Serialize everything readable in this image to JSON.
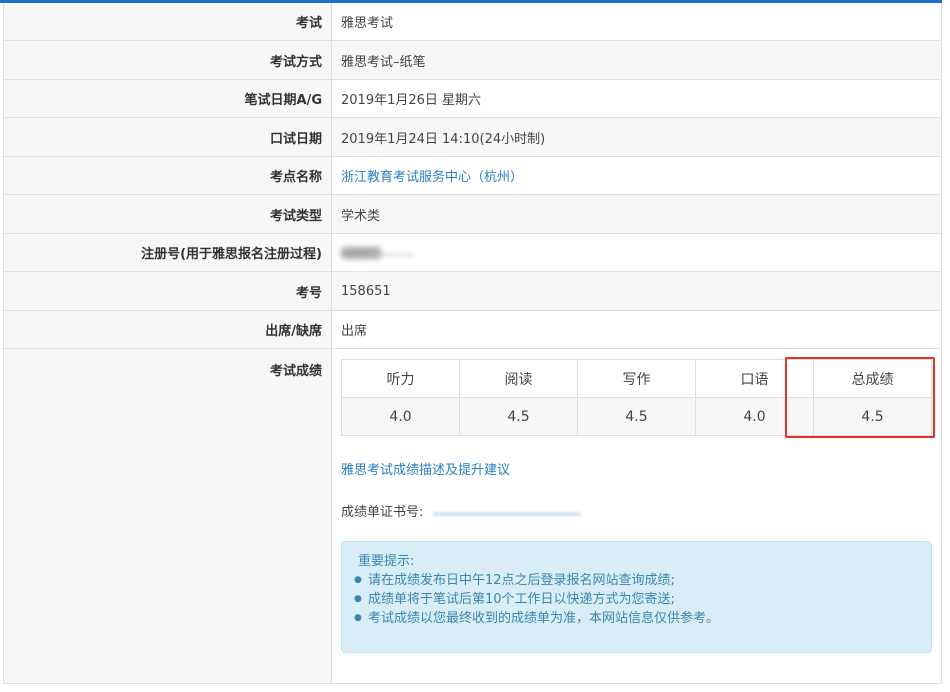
{
  "rows": [
    {
      "label": "考试",
      "value": "雅思考试"
    },
    {
      "label": "考试方式",
      "value": "雅思考试–纸笔"
    },
    {
      "label": "笔试日期A/G",
      "value": "2019年1月26日 星期六"
    },
    {
      "label": "口试日期",
      "value": "2019年1月24日 14:10(24小时制)"
    },
    {
      "label": "考点名称",
      "value": "浙江教育考试服务中心（杭州）"
    },
    {
      "label": "考试类型",
      "value": "学术类"
    },
    {
      "label": "注册号(用于雅思报名注册过程)",
      "value": ""
    },
    {
      "label": "考号",
      "value": "158651"
    },
    {
      "label": "出席/缺席",
      "value": "出席"
    }
  ],
  "scores": {
    "label": "考试成绩",
    "headers": [
      "听力",
      "阅读",
      "写作",
      "口语",
      "总成绩"
    ],
    "values": [
      "4.0",
      "4.5",
      "4.5",
      "4.0",
      "4.5"
    ],
    "advice_link": "雅思考试成绩描述及提升建议",
    "cert_label": "成绩单证书号:"
  },
  "notice": {
    "title": "重要提示:",
    "items": [
      "请在成绩发布日中午12点之后登录报名网站查询成绩;",
      "成绩单将于笔试后第10个工作日以快递方式为您寄送;",
      "考试成绩以您最终收到的成绩单为准，本网站信息仅供参考。"
    ]
  },
  "colors": {
    "accent": "#1f6fcf",
    "link": "#2a7fc0",
    "highlight": "#e0312c",
    "notice_bg": "#d9edf7"
  }
}
